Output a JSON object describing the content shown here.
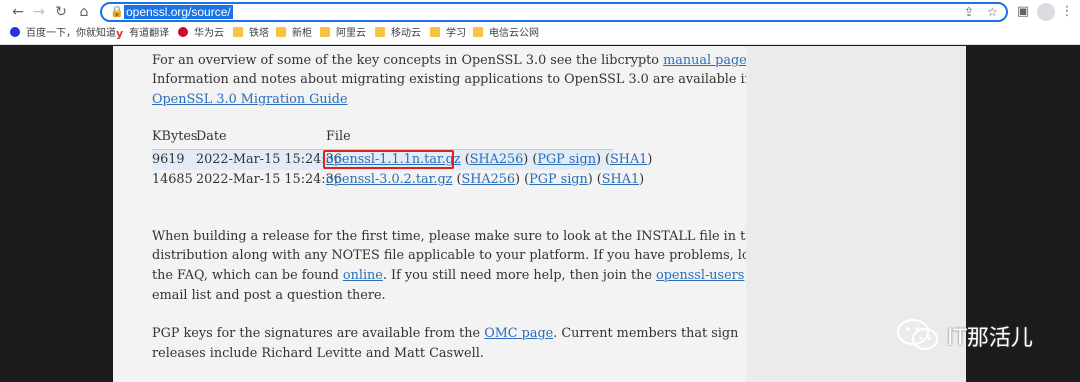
{
  "browser": {
    "url": "openssl.org/source/",
    "bookmarks": [
      "百度一下，你就知道",
      "有道翻译",
      "华为云",
      "铁塔",
      "新柜",
      "阿里云",
      "移动云",
      "学习",
      "电信云公网"
    ]
  },
  "article": {
    "intro_line1_prefix": "For an overview of some of the key concepts in OpenSSL 3.0 see the libcrypto ",
    "intro_link_manual": "manual page",
    "intro_line1_suffix": ".",
    "intro_line2": "Information and notes about migrating existing applications to OpenSSL 3.0 are available in the",
    "intro_link_migration": "OpenSSL 3.0 Migration Guide",
    "table": {
      "headers": [
        "KBytes",
        "Date",
        "File"
      ],
      "rows": [
        {
          "kbytes": "9619",
          "date": "2022-Mar-15 15:24:36",
          "file": "openssl-1.1.1n.tar.gz",
          "sha256": "SHA256",
          "pgp": "PGP sign",
          "sha1": "SHA1"
        },
        {
          "kbytes": "14685",
          "date": "2022-Mar-15 15:24:36",
          "file": "openssl-3.0.2.tar.gz",
          "sha256": "SHA256",
          "pgp": "PGP sign",
          "sha1": "SHA1"
        }
      ]
    },
    "build_line1": "When building a release for the first time, please make sure to look at the INSTALL file in the",
    "build_line2": "distribution along with any NOTES file applicable to your platform. If you have problems, look at",
    "build_line3_prefix": "the FAQ, which can be found ",
    "build_link_online": "online",
    "build_line3_middle": ". If you still need more help, then join the ",
    "build_link_users": "openssl-users",
    "build_line4": "email list and post a question there.",
    "pgp_line1_prefix": "PGP keys for the signatures are available from the ",
    "pgp_link_omc": "OMC page",
    "pgp_line1_suffix": ". Current members that sign",
    "pgp_line2": "releases include Richard Levitte and Matt Caswell."
  },
  "watermark": {
    "text": "IT那活儿"
  },
  "colors": {
    "link": "#2a6ebb",
    "highlight_box": "#e02020",
    "omnibox_border": "#1a73e8",
    "row_stripe": "#e2ecf6"
  }
}
